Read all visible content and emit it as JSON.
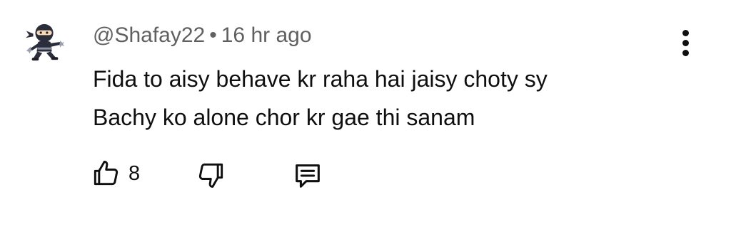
{
  "comment": {
    "author": "@Shafay22",
    "separator": "•",
    "time": "16 hr ago",
    "text_lines": [
      "Fida to aisy behave kr raha hai jaisy choty sy",
      "Bachy ko alone chor kr gae thi sanam"
    ],
    "like_count": "8",
    "icons": {
      "avatar": "ninja-avatar",
      "more": "more-vert-icon",
      "like": "thumb-up-icon",
      "dislike": "thumb-down-icon",
      "reply": "reply-comment-icon"
    }
  }
}
